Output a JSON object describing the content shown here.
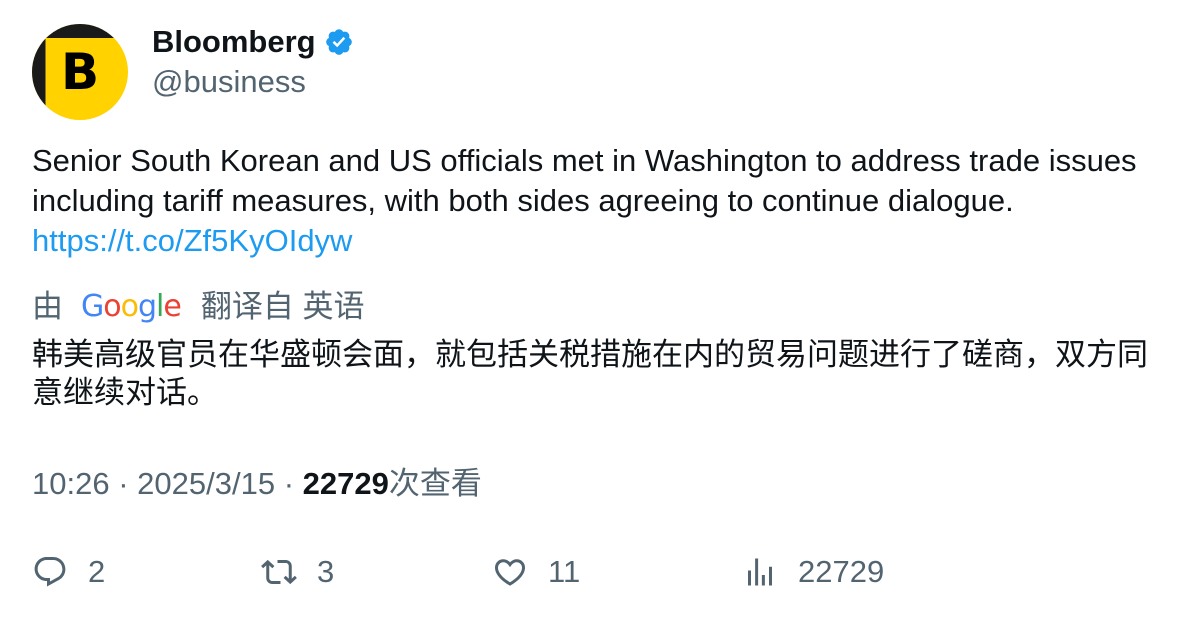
{
  "author": {
    "display_name": "Bloomberg",
    "handle": "@business",
    "avatar_letter": "B",
    "verified": true,
    "avatar_colors": {
      "background": "#ffd200",
      "accent": "#1a1a1a"
    }
  },
  "tweet": {
    "text": "Senior South Korean and US officials met in Washington to address trade issues including tariff measures, with both sides agreeing to continue dialogue.",
    "link": "https://t.co/Zf5KyOIdyw"
  },
  "translation": {
    "prefix": "由",
    "provider": "Google",
    "suffix": "翻译自 英语",
    "text": "韩美高级官员在华盛顿会面，就包括关税措施在内的贸易问题进行了磋商，双方同意继续对话。"
  },
  "meta": {
    "time": "10:26",
    "separator": "·",
    "date": "2025/3/15",
    "views": "22729",
    "views_label": "次查看"
  },
  "actions": {
    "replies": "2",
    "reposts": "3",
    "likes": "11",
    "views": "22729"
  },
  "colors": {
    "link": "#1d9bf0",
    "secondary_text": "#536471",
    "primary_text": "#0f1419",
    "verified_badge": "#1d9bf0"
  },
  "icons": [
    "verified-badge-icon",
    "reply-icon",
    "repost-icon",
    "like-icon",
    "views-icon"
  ]
}
